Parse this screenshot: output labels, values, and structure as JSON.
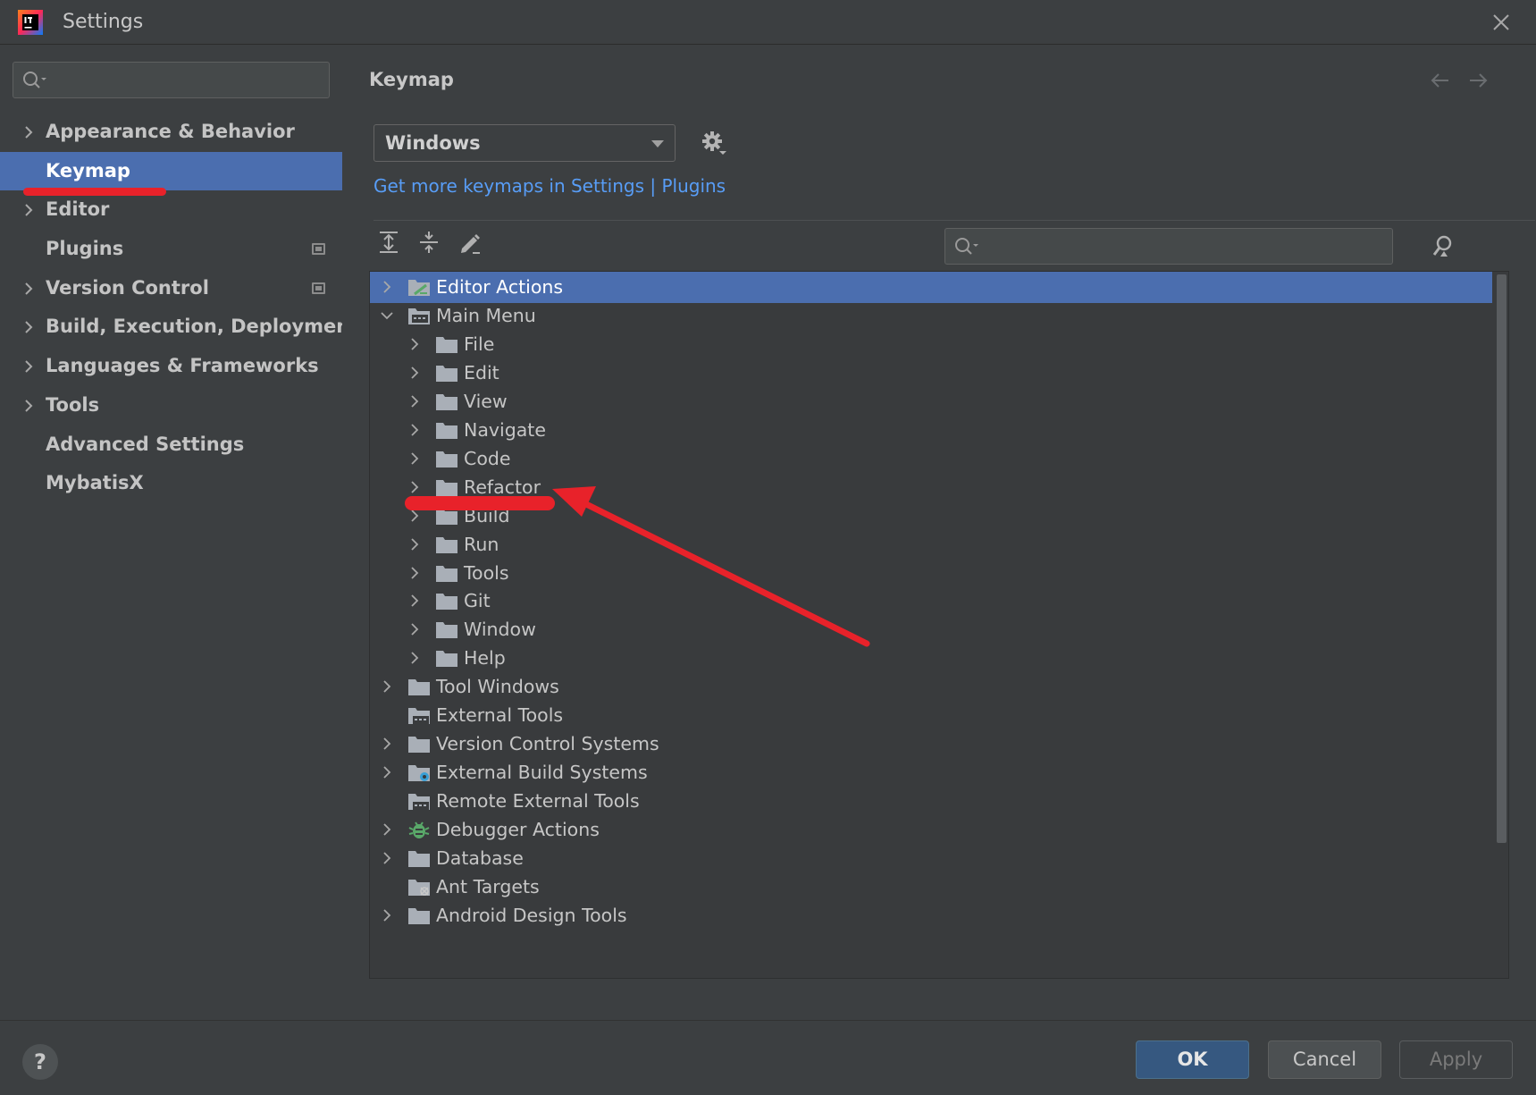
{
  "window": {
    "title": "Settings",
    "logo_icon": "intellij-idea-icon",
    "close_icon": "close-icon"
  },
  "sidebar": {
    "search_placeholder": "",
    "items": [
      {
        "label": "Appearance & Behavior",
        "expandable": true,
        "selected": false,
        "project_icon": false
      },
      {
        "label": "Keymap",
        "expandable": false,
        "selected": true,
        "project_icon": false
      },
      {
        "label": "Editor",
        "expandable": true,
        "selected": false,
        "project_icon": false
      },
      {
        "label": "Plugins",
        "expandable": false,
        "selected": false,
        "project_icon": true
      },
      {
        "label": "Version Control",
        "expandable": true,
        "selected": false,
        "project_icon": true
      },
      {
        "label": "Build, Execution, Deployment",
        "expandable": true,
        "selected": false,
        "project_icon": false
      },
      {
        "label": "Languages & Frameworks",
        "expandable": true,
        "selected": false,
        "project_icon": false
      },
      {
        "label": "Tools",
        "expandable": true,
        "selected": false,
        "project_icon": false
      },
      {
        "label": "Advanced Settings",
        "expandable": false,
        "selected": false,
        "project_icon": false
      },
      {
        "label": "MybatisX",
        "expandable": false,
        "selected": false,
        "project_icon": false
      }
    ]
  },
  "main": {
    "title": "Keymap",
    "keymap_value": "Windows",
    "plugins_link": "Get more keymaps in Settings | Plugins",
    "tree_search_placeholder": "",
    "toolbar": [
      "expand-all-icon",
      "collapse-all-icon",
      "edit-shortcut-icon"
    ],
    "tree": [
      {
        "label": "Editor Actions",
        "level": 0,
        "expander": "right",
        "icon": "editor-actions-icon",
        "selected": true
      },
      {
        "label": "Main Menu",
        "level": 0,
        "expander": "down",
        "icon": "menu-folder-icon",
        "selected": false
      },
      {
        "label": "File",
        "level": 1,
        "expander": "right",
        "icon": "folder-icon",
        "selected": false
      },
      {
        "label": "Edit",
        "level": 1,
        "expander": "right",
        "icon": "folder-icon",
        "selected": false
      },
      {
        "label": "View",
        "level": 1,
        "expander": "right",
        "icon": "folder-icon",
        "selected": false
      },
      {
        "label": "Navigate",
        "level": 1,
        "expander": "right",
        "icon": "folder-icon",
        "selected": false
      },
      {
        "label": "Code",
        "level": 1,
        "expander": "right",
        "icon": "folder-icon",
        "selected": false
      },
      {
        "label": "Refactor",
        "level": 1,
        "expander": "right",
        "icon": "folder-icon",
        "selected": false
      },
      {
        "label": "Build",
        "level": 1,
        "expander": "right",
        "icon": "folder-icon",
        "selected": false
      },
      {
        "label": "Run",
        "level": 1,
        "expander": "right",
        "icon": "folder-icon",
        "selected": false
      },
      {
        "label": "Tools",
        "level": 1,
        "expander": "right",
        "icon": "folder-icon",
        "selected": false
      },
      {
        "label": "Git",
        "level": 1,
        "expander": "right",
        "icon": "folder-icon",
        "selected": false
      },
      {
        "label": "Window",
        "level": 1,
        "expander": "right",
        "icon": "folder-icon",
        "selected": false
      },
      {
        "label": "Help",
        "level": 1,
        "expander": "right",
        "icon": "folder-icon",
        "selected": false
      },
      {
        "label": "Tool Windows",
        "level": 0,
        "expander": "right",
        "icon": "folder-icon",
        "selected": false
      },
      {
        "label": "External Tools",
        "level": 0,
        "expander": "none",
        "icon": "external-tools-icon",
        "selected": false
      },
      {
        "label": "Version Control Systems",
        "level": 0,
        "expander": "right",
        "icon": "folder-icon",
        "selected": false
      },
      {
        "label": "External Build Systems",
        "level": 0,
        "expander": "right",
        "icon": "build-systems-icon",
        "selected": false
      },
      {
        "label": "Remote External Tools",
        "level": 0,
        "expander": "none",
        "icon": "external-tools-icon",
        "selected": false
      },
      {
        "label": "Debugger Actions",
        "level": 0,
        "expander": "right",
        "icon": "bug-icon",
        "selected": false
      },
      {
        "label": "Database",
        "level": 0,
        "expander": "right",
        "icon": "folder-icon",
        "selected": false
      },
      {
        "label": "Ant Targets",
        "level": 0,
        "expander": "none",
        "icon": "ant-icon",
        "selected": false
      },
      {
        "label": "Android Design Tools",
        "level": 0,
        "expander": "right",
        "icon": "folder-icon",
        "selected": false
      }
    ]
  },
  "footer": {
    "help_label": "?",
    "ok_label": "OK",
    "cancel_label": "Cancel",
    "apply_label": "Apply"
  },
  "colors": {
    "selection": "#4b6eaf",
    "link": "#589df6",
    "annotation": "#e8222a"
  }
}
